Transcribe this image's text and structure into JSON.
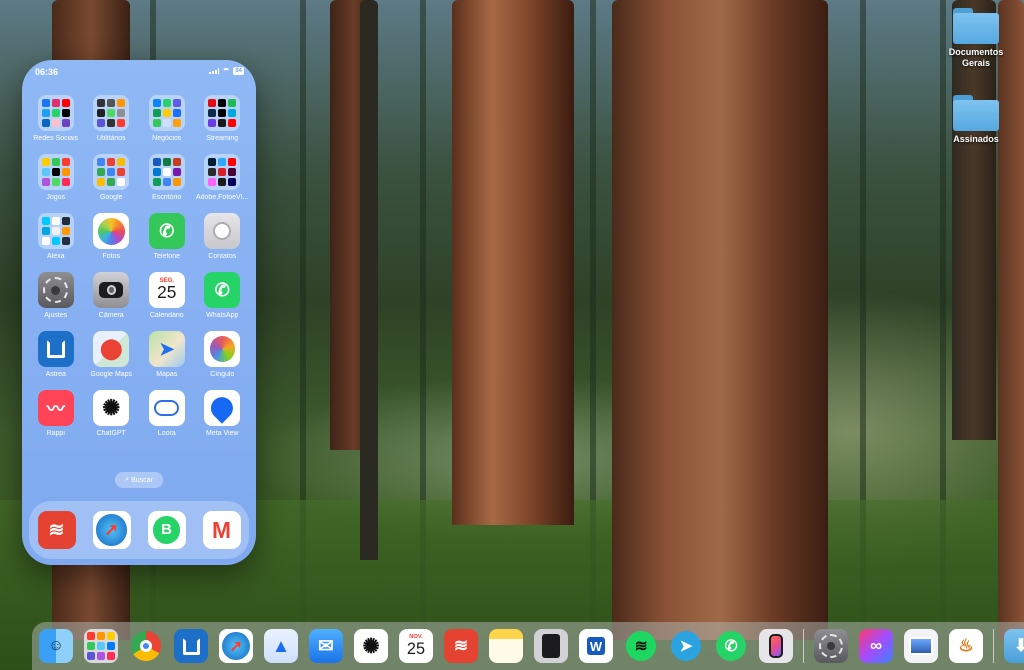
{
  "phone": {
    "status": {
      "time": "06:36",
      "battery": "84"
    },
    "apps": [
      {
        "name": "folder-redes-sociais",
        "label": "Redes Sociais",
        "type": "folder",
        "colors": [
          "#1877f2",
          "#e1306c",
          "#ff0000",
          "#1da1f2",
          "#25d366",
          "#000000",
          "#0a66c2",
          "#ffc0cb",
          "#6f42c1"
        ]
      },
      {
        "name": "folder-utilitarios",
        "label": "Utilitários",
        "type": "folder",
        "colors": [
          "#333333",
          "#555555",
          "#ff9500",
          "#222222",
          "#4cd964",
          "#8e8e93",
          "#5856d6",
          "#333333",
          "#ff3b30"
        ]
      },
      {
        "name": "folder-negocios",
        "label": "Negócios",
        "type": "folder",
        "colors": [
          "#0a84ff",
          "#25d366",
          "#5e5ce6",
          "#0f9d58",
          "#ffcc00",
          "#1d6ef7",
          "#34c759",
          "#cfe0ff",
          "#ff9f0a"
        ]
      },
      {
        "name": "folder-streaming",
        "label": "Streaming",
        "type": "folder",
        "colors": [
          "#e50914",
          "#000000",
          "#1db954",
          "#0f2b46",
          "#000000",
          "#00a8e1",
          "#6c3ce2",
          "#1a1a1a",
          "#ff0000"
        ]
      },
      {
        "name": "folder-jogos",
        "label": "Jogos",
        "type": "folder",
        "colors": [
          "#ffcc00",
          "#34c759",
          "#ff3b30",
          "#5ac8fa",
          "#000000",
          "#ff9500",
          "#af52de",
          "#4cd964",
          "#ff2d55"
        ]
      },
      {
        "name": "folder-google",
        "label": "Google",
        "type": "folder",
        "colors": [
          "#4285f4",
          "#ea4335",
          "#fbbc05",
          "#34a853",
          "#4285f4",
          "#ea4335",
          "#fbbc05",
          "#34a853",
          "#ffffff"
        ]
      },
      {
        "name": "folder-escritorio",
        "label": "Escritório",
        "type": "folder",
        "colors": [
          "#185abd",
          "#107c41",
          "#c43e1c",
          "#0078d4",
          "#ffffff",
          "#7719aa",
          "#0f9d58",
          "#4285f4",
          "#ff9500"
        ]
      },
      {
        "name": "folder-adobe",
        "label": "Adobe,FotoeVí...",
        "type": "folder",
        "colors": [
          "#001e36",
          "#31a8ff",
          "#ff0000",
          "#2c2c2c",
          "#da1f26",
          "#470137",
          "#ff61f6",
          "#1d1d1d",
          "#00005b"
        ]
      },
      {
        "name": "app-alexa",
        "label": "Alexa",
        "type": "folder",
        "colors": [
          "#00caff",
          "#ffffff",
          "#1f2b38",
          "#00a8e1",
          "#f0f0f0",
          "#ff9900",
          "#ffffff",
          "#00caff",
          "#232f3e"
        ]
      },
      {
        "name": "app-fotos",
        "label": "Fotos",
        "type": "photos"
      },
      {
        "name": "app-telefone",
        "label": "Telefone",
        "type": "solid",
        "bg": "#34c759",
        "glyph": "✆"
      },
      {
        "name": "app-contatos",
        "label": "Contatos",
        "type": "contacts"
      },
      {
        "name": "app-ajustes",
        "label": "Ajustes",
        "type": "settings"
      },
      {
        "name": "app-camera",
        "label": "Câmera",
        "type": "camera"
      },
      {
        "name": "app-calendario",
        "label": "Calendário",
        "type": "calendar",
        "day": "SEG.",
        "date": "25"
      },
      {
        "name": "app-whatsapp",
        "label": "WhatsApp",
        "type": "solid",
        "bg": "#25d366",
        "glyph": "✆"
      },
      {
        "name": "app-astrea",
        "label": "Astrea",
        "type": "astrea"
      },
      {
        "name": "app-google-maps",
        "label": "Google Maps",
        "type": "gmaps"
      },
      {
        "name": "app-mapas",
        "label": "Mapas",
        "type": "maps"
      },
      {
        "name": "app-cingulo",
        "label": "Cíngulo",
        "type": "cingulo"
      },
      {
        "name": "app-rappi",
        "label": "Rappi",
        "type": "solid",
        "bg": "#ff4458",
        "glyph": "〰"
      },
      {
        "name": "app-chatgpt",
        "label": "ChatGPT",
        "type": "chatgpt"
      },
      {
        "name": "app-loora",
        "label": "Loora",
        "type": "loora"
      },
      {
        "name": "app-meta-view",
        "label": "Meta View",
        "type": "metaview"
      }
    ],
    "search_label": "Buscar",
    "dock": [
      {
        "name": "phone-dock-todoist",
        "type": "todoist"
      },
      {
        "name": "phone-dock-safari",
        "type": "safari"
      },
      {
        "name": "phone-dock-whatsapp-business",
        "type": "wabusiness"
      },
      {
        "name": "phone-dock-gmail",
        "type": "gmail"
      }
    ]
  },
  "desktop_folders": [
    {
      "name": "desktop-folder-documentos-gerais",
      "label": "Documentos Gerais"
    },
    {
      "name": "desktop-folder-assinados",
      "label": "Assinados"
    }
  ],
  "dock": {
    "calendar_month": "NOV.",
    "calendar_date": "25",
    "apps": [
      {
        "name": "dock-finder",
        "type": "finder"
      },
      {
        "name": "dock-launchpad",
        "type": "launchpad"
      },
      {
        "name": "dock-chrome",
        "type": "chrome"
      },
      {
        "name": "dock-astrea",
        "type": "astrea"
      },
      {
        "name": "dock-safari",
        "type": "safari"
      },
      {
        "name": "dock-testflight",
        "type": "arrow"
      },
      {
        "name": "dock-mail",
        "type": "mail"
      },
      {
        "name": "dock-chatgpt",
        "type": "chatgpt"
      },
      {
        "name": "dock-calendar",
        "type": "calendar"
      },
      {
        "name": "dock-todoist",
        "type": "todoist"
      },
      {
        "name": "dock-notes",
        "type": "notes"
      },
      {
        "name": "dock-calculator",
        "type": "calculator"
      },
      {
        "name": "dock-word",
        "type": "word"
      },
      {
        "name": "dock-spotify",
        "type": "spotify"
      },
      {
        "name": "dock-telegram",
        "type": "telegram"
      },
      {
        "name": "dock-whatsapp",
        "type": "whatsapp"
      },
      {
        "name": "dock-iphone-mirroring",
        "type": "iphone"
      },
      {
        "name": "sep"
      },
      {
        "name": "dock-system-settings",
        "type": "settings"
      },
      {
        "name": "dock-creative-cloud",
        "type": "cc"
      },
      {
        "name": "dock-preview",
        "type": "preview"
      },
      {
        "name": "dock-java",
        "type": "java"
      },
      {
        "name": "sep"
      },
      {
        "name": "dock-downloads",
        "type": "downloads"
      }
    ]
  }
}
